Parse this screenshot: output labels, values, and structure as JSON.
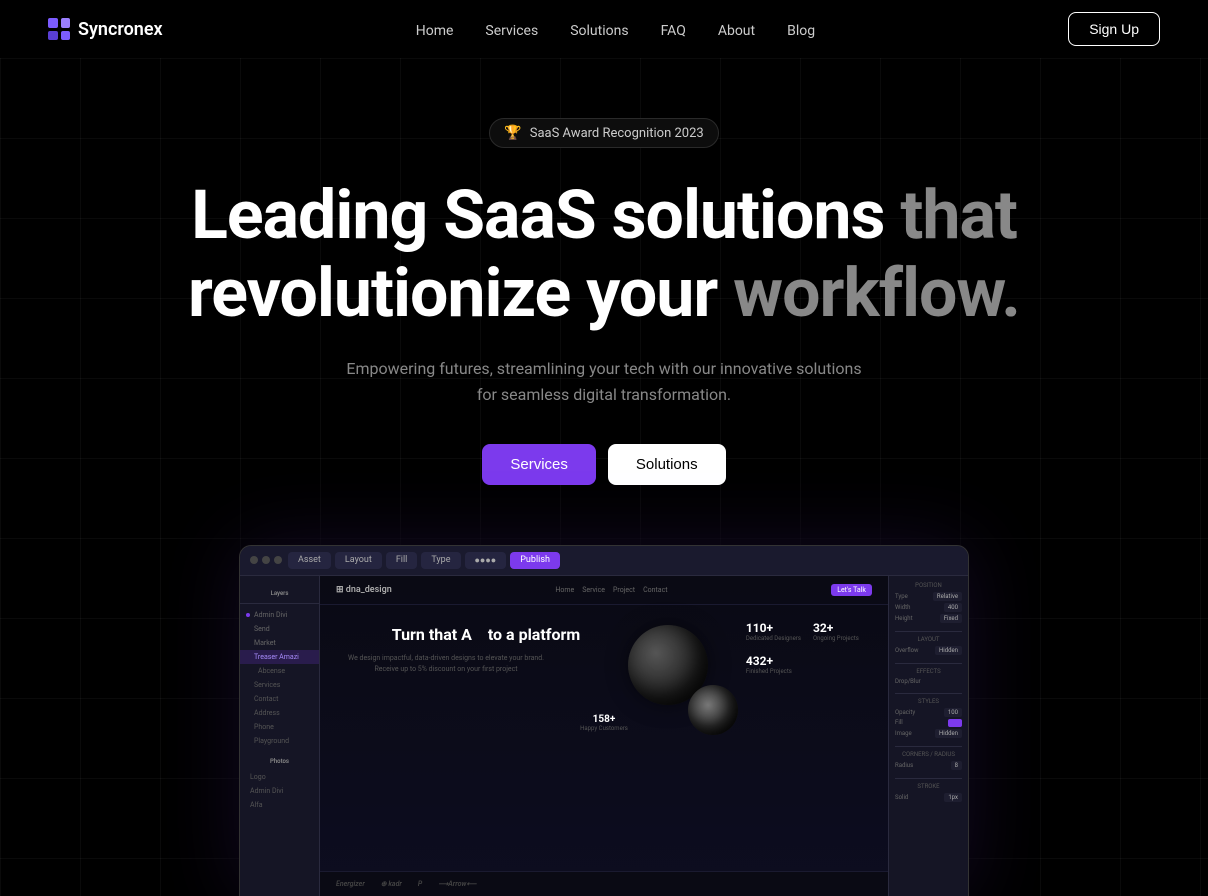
{
  "brand": {
    "name": "Syncronex"
  },
  "nav": {
    "links": [
      {
        "id": "home",
        "label": "Home"
      },
      {
        "id": "services",
        "label": "Services"
      },
      {
        "id": "solutions",
        "label": "Solutions"
      },
      {
        "id": "faq",
        "label": "FAQ"
      },
      {
        "id": "about",
        "label": "About"
      },
      {
        "id": "blog",
        "label": "Blog"
      }
    ],
    "cta": "Sign Up"
  },
  "hero": {
    "badge": "SaaS Award Recognition 2023",
    "heading_line1_white": "Leading SaaS",
    "heading_line1_gray": "solutions",
    "heading_line1_tail": "that",
    "heading_line2_white": "revolutionize",
    "heading_line2_gray": "your",
    "heading_line2_tail": "workflow.",
    "subtitle": "Empowering futures, streamlining your tech with our innovative solutions for seamless digital transformation.",
    "btn_services": "Services",
    "btn_solutions": "Solutions"
  },
  "mockup": {
    "toolbar": {
      "tabs": [
        "Asset",
        "Layout",
        "Fill",
        "Type",
        "Publish"
      ],
      "active_tab": "Publish"
    },
    "inner_website": {
      "logo": "dna_design",
      "nav_links": [
        "Home",
        "Service",
        "Project",
        "Contact"
      ],
      "cta": "Let's Talk",
      "hero_title": "Turn that A    to a platform",
      "hero_sub": "We design impactful, data-driven designs to elevate your brand. Receive up to 5% discount on your first project",
      "stats": [
        {
          "num": "110+",
          "label": "Dedicated Designers"
        },
        {
          "num": "432+",
          "label": "Finished Projects"
        },
        {
          "num": "32+",
          "label": "Ongoing Projects"
        },
        {
          "num": "158+",
          "label": "Happy Customers"
        }
      ]
    },
    "brands": [
      "Energizer",
      "kadr",
      "P",
      "Arrow"
    ],
    "sidebar_layers": [
      "Admin Divi",
      "Send",
      "Market",
      "Services",
      "Contact",
      "Address",
      "Phone",
      "Playground"
    ],
    "right_panel": {
      "sections": [
        {
          "label": "Position",
          "rows": [
            {
              "key": "Type",
              "val": "Relative"
            },
            {
              "key": "Width",
              "val": "400"
            },
            {
              "key": "Height",
              "val": "Fixed"
            }
          ]
        },
        {
          "label": "Layout",
          "rows": [
            {
              "key": "Overflow",
              "val": "Hidden"
            }
          ]
        }
      ]
    }
  }
}
